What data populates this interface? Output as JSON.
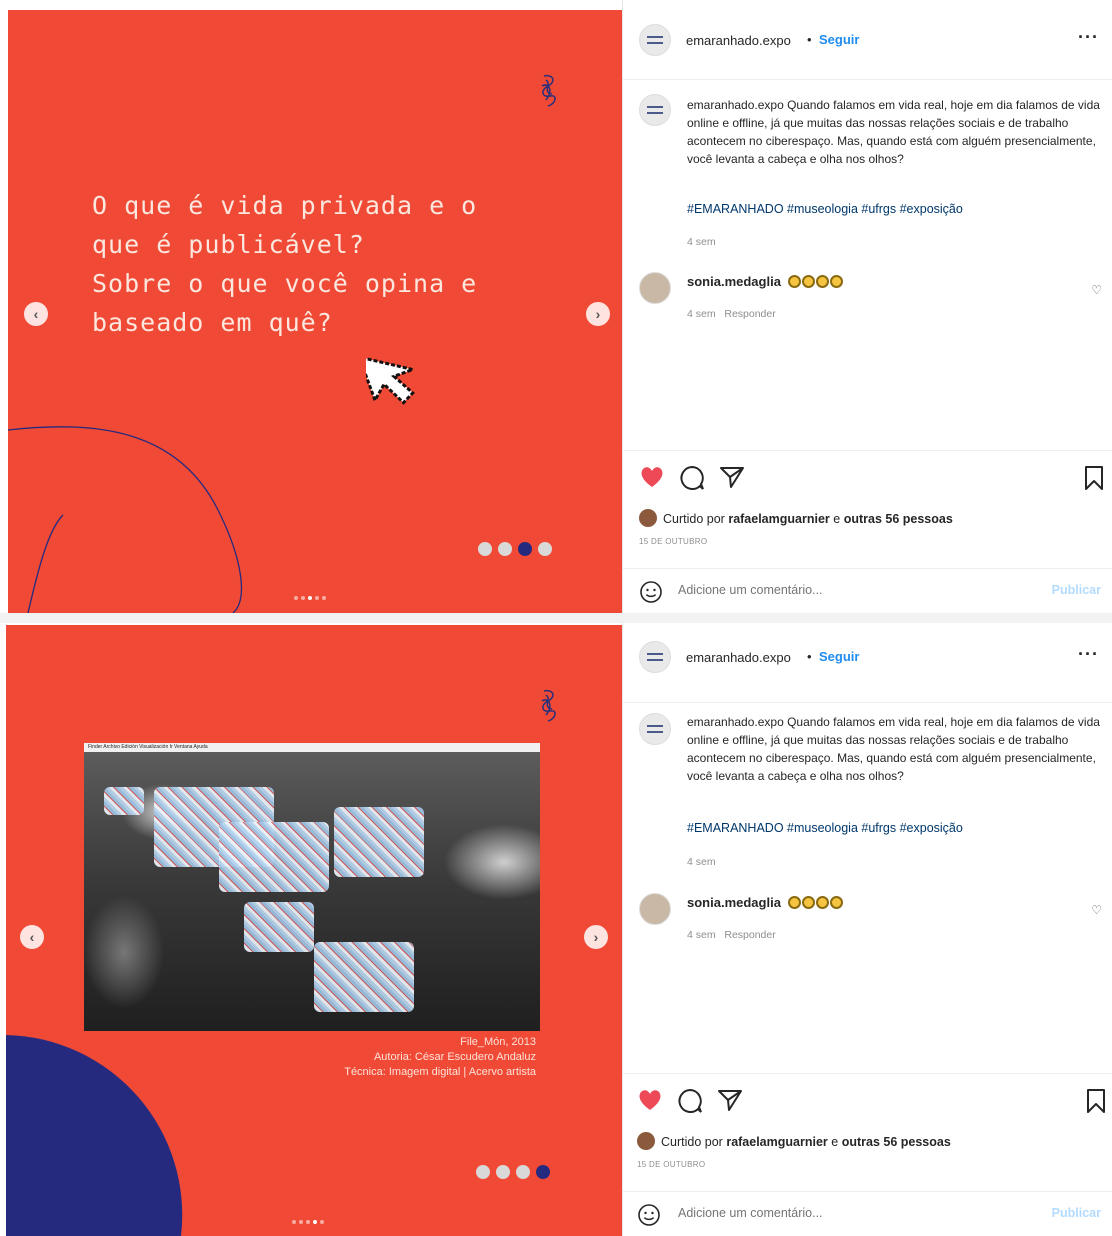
{
  "account": {
    "username": "emaranhado.expo",
    "separator": "•",
    "follow_label": "Seguir",
    "more_label": "···"
  },
  "caption": {
    "username": "emaranhado.expo",
    "text": "Quando falamos em vida real, hoje em dia falamos de vida online e offline, já que muitas das nossas relações sociais e de trabalho acontecem no ciberespaço. Mas, quando está com alguém presencialmente, você levanta a cabeça e olha nos olhos?",
    "hashtags": "#EMARANHADO #museologia #ufrgs #exposição",
    "time": "4 sem"
  },
  "comment": {
    "username": "sonia.medaglia",
    "emoji_count": 4,
    "time": "4 sem",
    "reply_label": "Responder"
  },
  "likes": {
    "prefix": "Curtido por",
    "user": "rafaelamguarnier",
    "connector": "e",
    "others": "outras 56 pessoas"
  },
  "date": "15 DE OUTUBRO",
  "add_comment": {
    "placeholder": "Adicione um comentário...",
    "publish_label": "Publicar"
  },
  "slide1": {
    "lines": [
      "O que é vida privada e o",
      "que é publicável?",
      "Sobre o que você opina e",
      "baseado em quê?"
    ],
    "active_dot": 3,
    "total_dots": 4
  },
  "slide2": {
    "menubar": "Finder  Archivo  Edición  Visualización  Ir  Ventana  Ayuda",
    "credit_lines": [
      "File_Món, 2013",
      "Autoria: César Escudero Andaluz",
      "Técnica: Imagem digital | Acervo artista"
    ],
    "active_dot": 4,
    "total_dots": 4
  },
  "colors": {
    "slide_bg": "#f04a36",
    "accent_navy": "#262a7e",
    "like_red": "#ed4956",
    "link_blue": "#1f8cf0"
  },
  "icons": [
    "heart-icon",
    "comment-icon",
    "share-icon",
    "bookmark-icon",
    "emoji-icon",
    "arrow-left-icon",
    "arrow-right-icon",
    "cursor-icon",
    "scribble-logo-icon"
  ]
}
